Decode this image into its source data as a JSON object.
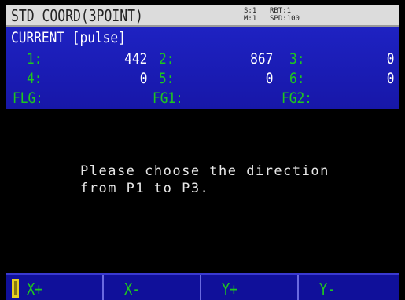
{
  "title": "STD COORD(3POINT)",
  "status": {
    "s": "S:1",
    "m": "M:1",
    "rbt": "RBT:1",
    "spd": "SPD:100"
  },
  "current_label": "CURRENT [pulse]",
  "axes": [
    {
      "label": "1:",
      "value": "442"
    },
    {
      "label": "2:",
      "value": "867"
    },
    {
      "label": "3:",
      "value": "0"
    },
    {
      "label": "4:",
      "value": "0"
    },
    {
      "label": "5:",
      "value": "0"
    },
    {
      "label": "6:",
      "value": "0"
    }
  ],
  "flags": [
    {
      "label": "FLG:"
    },
    {
      "label": "FG1:"
    },
    {
      "label": "FG2:"
    }
  ],
  "message": {
    "line1": "Please choose the direction",
    "line2": "from P1 to P3."
  },
  "function_keys": [
    {
      "label": "X+"
    },
    {
      "label": "X-"
    },
    {
      "label": "Y+"
    },
    {
      "label": "Y-"
    }
  ],
  "colors": {
    "panel_blue": "#1a1ab8",
    "label_green": "#1ec81e",
    "indicator_yellow": "#e8d020"
  }
}
